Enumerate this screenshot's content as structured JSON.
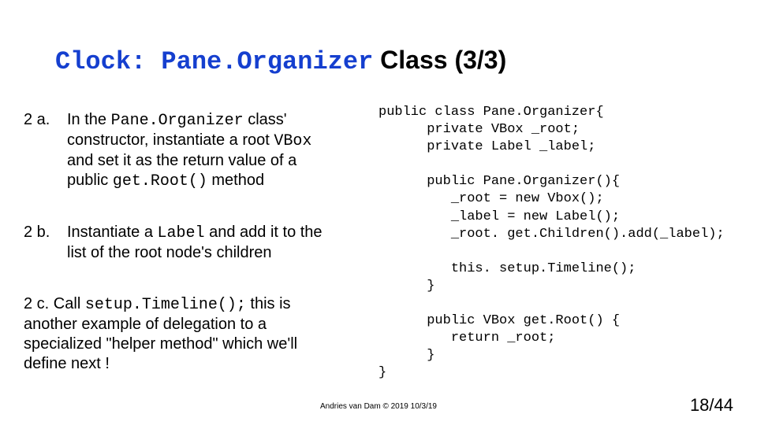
{
  "title": {
    "p1": "Clock: Pane.Organizer",
    "p2": " Class (3/3)"
  },
  "left": {
    "a": {
      "label": "2 a.",
      "t1": "In the ",
      "c1": "Pane.Organizer",
      "t2": " class' constructor, instantiate a root ",
      "c2": "VBox",
      "t3": " and set it as the return value of a public ",
      "c3": "get.Root()",
      "t4": " method"
    },
    "b": {
      "label": "2 b.",
      "t1": "Instantiate a ",
      "c1": "Label",
      "t2": " and add it to the list of the root node's children"
    },
    "c": {
      "label": "2 c.",
      "t1": "    Call ",
      "c1": "setup.Timeline();",
      "t2": " this is another example of delegation to a specialized \"helper method\" which we'll define next !"
    }
  },
  "code": {
    "l1": "public class Pane.Organizer{",
    "l2": "      private VBox _root;",
    "l3": "      private Label _label;",
    "l4": "",
    "l5": "      public Pane.Organizer(){",
    "l6": "         _root = new Vbox();",
    "l7": "         _label = new Label();",
    "l8": "         _root. get.Children().add(_label);",
    "l9": "",
    "l10": "         this. setup.Timeline();",
    "l11": "      }",
    "l12": "",
    "l13": "      public VBox get.Root() {",
    "l14": "         return _root;",
    "l15": "      }",
    "l16": "}"
  },
  "footer": "Andries van Dam © 2019 10/3/19",
  "pagenum": "18/44"
}
